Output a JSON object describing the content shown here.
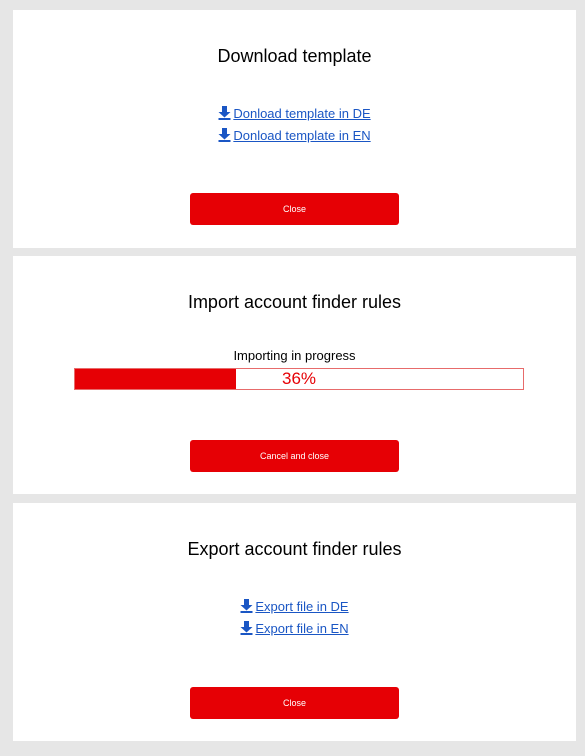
{
  "download_template": {
    "title": "Download template",
    "links": [
      "Donload template in DE",
      "Donload template in EN"
    ],
    "close_label": "Close"
  },
  "import_rules": {
    "title": "Import account finder rules",
    "status": "Importing in progress",
    "progress_percent": 36,
    "progress_text": "36%",
    "cancel_label": "Cancel and close"
  },
  "export_rules": {
    "title": "Export account finder rules",
    "links": [
      "Export file in DE",
      "Export file in EN"
    ],
    "close_label": "Close"
  },
  "colors": {
    "accent": "#e60005",
    "link": "#1a56c4",
    "background": "#e6e6e6"
  }
}
